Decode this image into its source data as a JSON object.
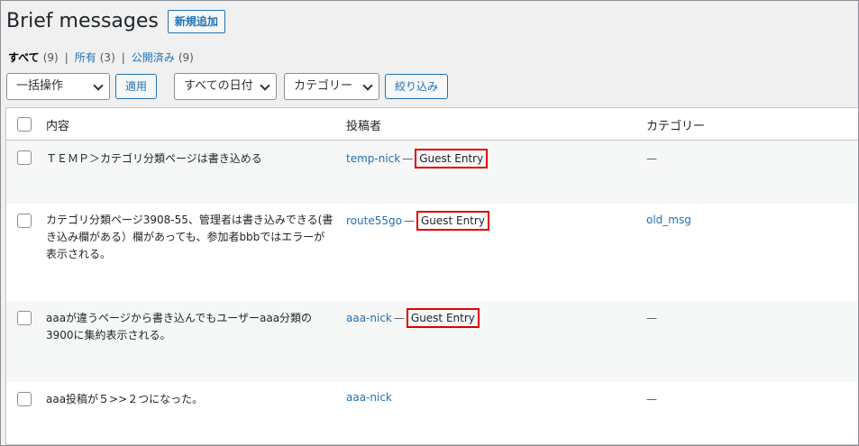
{
  "header": {
    "title": "Brief messages",
    "add_new_label": "新規追加"
  },
  "views": [
    {
      "label": "すべて",
      "count": "(9)"
    },
    {
      "label": "所有",
      "count": "(3)"
    },
    {
      "label": "公開済み",
      "count": "(9)"
    }
  ],
  "filters": {
    "bulk_actions": "一括操作",
    "apply": "適用",
    "dates": "すべての日付",
    "category": "カテゴリー",
    "filter": "絞り込み"
  },
  "table": {
    "headers": {
      "content": "内容",
      "author": "投稿者",
      "category": "カテゴリー"
    },
    "rows": [
      {
        "content": "ＴＥＭＰ＞カテゴリ分類ページは書き込める",
        "author": "temp-nick",
        "dash": "—",
        "badge": "Guest Entry",
        "category": "—"
      },
      {
        "content": "カテゴリ分類ページ3908-55、管理者は書き込みできる(書き込み欄がある）欄があっても、参加者bbbではエラーが表示される。",
        "author": "route55go",
        "dash": "—",
        "badge": "Guest Entry",
        "category": "old_msg"
      },
      {
        "content": "aaaが違うページから書き込んでもユーザーaaa分類の3900に集約表示される。",
        "author": "aaa-nick",
        "dash": "—",
        "badge": "Guest Entry",
        "category": "—"
      },
      {
        "content": "aaa投稿が５>>２つになった。",
        "author": "aaa-nick",
        "category": "—"
      }
    ]
  }
}
